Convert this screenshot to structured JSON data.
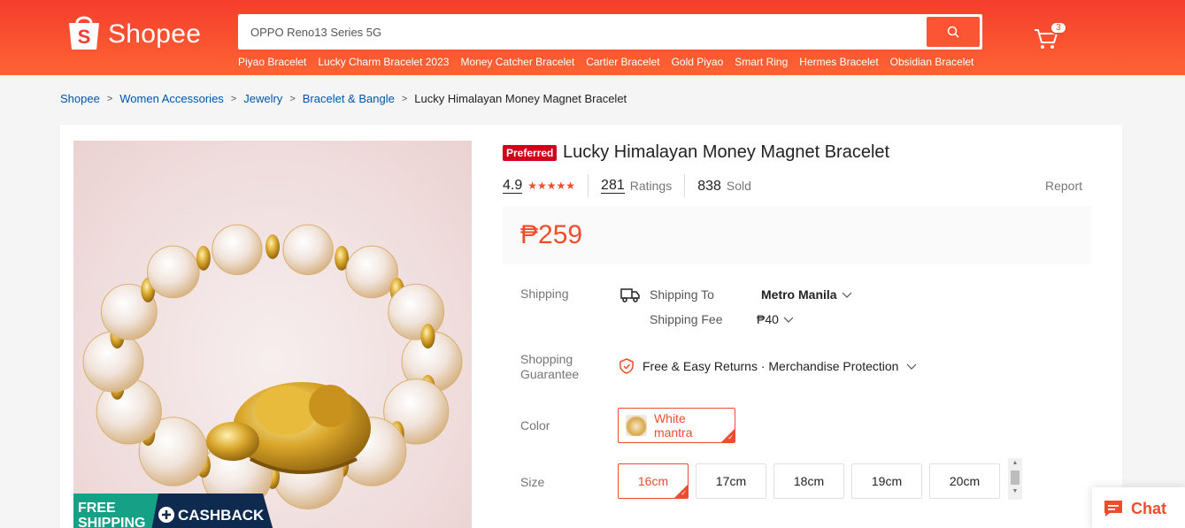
{
  "header": {
    "brand": "Shopee",
    "search_value": "OPPO Reno13 Series 5G",
    "suggestions": [
      "Piyao Bracelet",
      "Lucky Charm Bracelet 2023",
      "Money Catcher Bracelet",
      "Cartier Bracelet",
      "Gold Piyao",
      "Smart Ring",
      "Hermes Bracelet",
      "Obsidian Bracelet"
    ],
    "cart_count": "3"
  },
  "breadcrumb": {
    "items": [
      "Shopee",
      "Women Accessories",
      "Jewelry",
      "Bracelet & Bangle"
    ],
    "current": "Lucky Himalayan Money Magnet Bracelet"
  },
  "product": {
    "badge": "Preferred",
    "title": "Lucky Himalayan Money Magnet Bracelet",
    "rating": "4.9",
    "rating_value": 4.9,
    "ratings_count": "281",
    "ratings_label": "Ratings",
    "sold_count": "838",
    "sold_label": "Sold",
    "report": "Report",
    "price": "₱259"
  },
  "promo": {
    "line1": "FREE",
    "line2": "SHIPPING",
    "cashback": "CASHBACK"
  },
  "shipping": {
    "label": "Shipping",
    "to_label": "Shipping To",
    "to_value": "Metro Manila",
    "fee_label": "Shipping Fee",
    "fee_value": "₱40"
  },
  "guarantee": {
    "label_line1": "Shopping",
    "label_line2": "Guarantee",
    "text": "Free & Easy Returns · Merchandise Protection"
  },
  "color": {
    "label": "Color",
    "options": [
      "White mantra"
    ],
    "selected": "White mantra"
  },
  "size": {
    "label": "Size",
    "options": [
      "16cm",
      "17cm",
      "18cm",
      "19cm",
      "20cm"
    ],
    "selected": "16cm"
  },
  "chat": {
    "label": "Chat"
  },
  "colors": {
    "accent": "#ee4d2d",
    "header": "#f53d2d",
    "link": "#0055aa"
  }
}
